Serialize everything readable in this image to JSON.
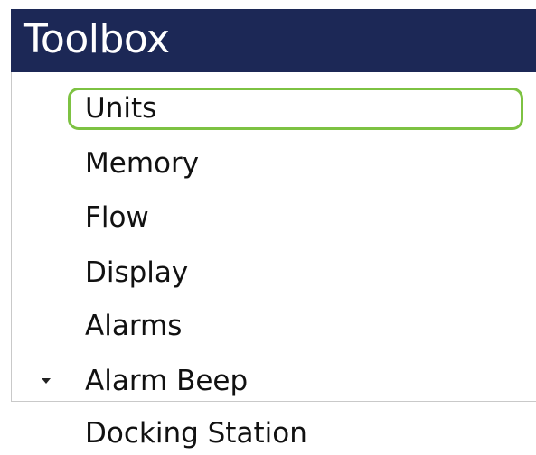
{
  "header": {
    "title": "Toolbox"
  },
  "toolbox": {
    "items": [
      {
        "label": "Units"
      },
      {
        "label": "Memory"
      },
      {
        "label": "Flow"
      },
      {
        "label": "Display"
      },
      {
        "label": "Alarms"
      },
      {
        "label": "Alarm Beep"
      },
      {
        "label": "Docking Station"
      }
    ],
    "selected_index": 0,
    "expander_icon": "caret-down-icon"
  },
  "colors": {
    "header_bg": "#1c2856",
    "selection_border": "#7dc242"
  }
}
